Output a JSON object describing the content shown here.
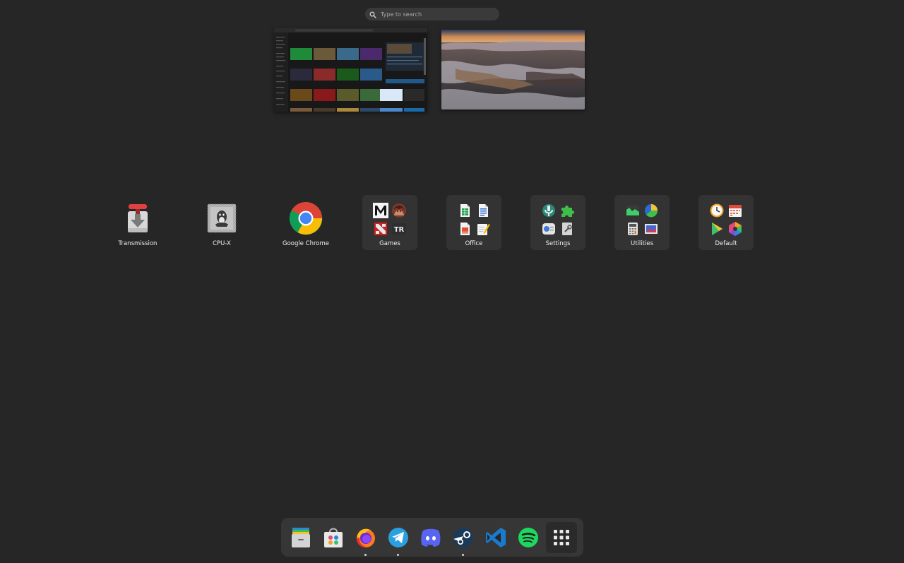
{
  "search": {
    "placeholder": "Type to search"
  },
  "workspaces": [
    {
      "name": "workspace-1"
    },
    {
      "name": "workspace-2"
    }
  ],
  "apps": [
    {
      "label": "Transmission",
      "icon": "transmission-icon"
    },
    {
      "label": "CPU-X",
      "icon": "cpu-x-icon"
    },
    {
      "label": "Google Chrome",
      "icon": "google-chrome-icon"
    },
    {
      "label": "Games",
      "icon": "folder-icon"
    },
    {
      "label": "Office",
      "icon": "folder-icon"
    },
    {
      "label": "Settings",
      "icon": "folder-icon"
    },
    {
      "label": "Utilities",
      "icon": "folder-icon"
    },
    {
      "label": "Default",
      "icon": "folder-icon"
    }
  ],
  "dock": [
    {
      "icon": "files-icon",
      "running": false
    },
    {
      "icon": "software-store-icon",
      "running": false
    },
    {
      "icon": "firefox-icon",
      "running": true
    },
    {
      "icon": "telegram-icon",
      "running": true
    },
    {
      "icon": "discord-icon",
      "running": false
    },
    {
      "icon": "steam-icon",
      "running": true
    },
    {
      "icon": "vscode-icon",
      "running": false
    },
    {
      "icon": "spotify-icon",
      "running": false
    },
    {
      "icon": "app-grid-icon",
      "running": false
    }
  ],
  "colors": {
    "background": "#262626",
    "dock": "#363636",
    "folder": "#333333",
    "search": "#3a3a3a"
  }
}
